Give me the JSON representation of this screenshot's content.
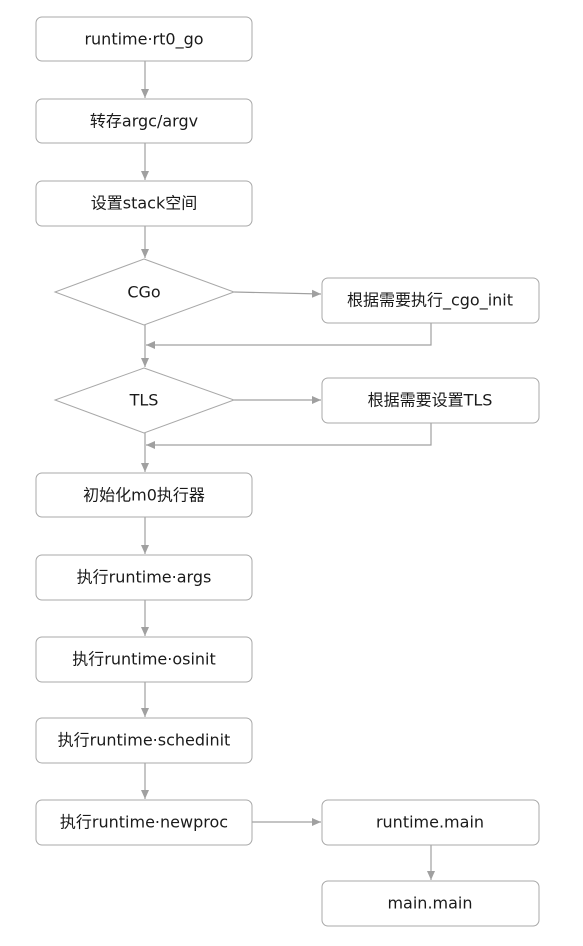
{
  "nodes": {
    "rt0_go": "runtime·rt0_go",
    "save_args": "转存argc/argv",
    "setup_stack": "设置stack空间",
    "cgo_decision": "CGo",
    "cgo_init": "根据需要执行_cgo_init",
    "tls_decision": "TLS",
    "setup_tls": "根据需要设置TLS",
    "init_m0": "初始化m0执行器",
    "args": "执行runtime·args",
    "osinit": "执行runtime·osinit",
    "schedinit": "执行runtime·schedinit",
    "newproc": "执行runtime·newproc",
    "runtime_main": "runtime.main",
    "main_main": "main.main"
  },
  "colors": {
    "border": "#a8a8a8",
    "edge": "#a0a0a0",
    "text": "#1a1a1a",
    "background": "#ffffff"
  }
}
